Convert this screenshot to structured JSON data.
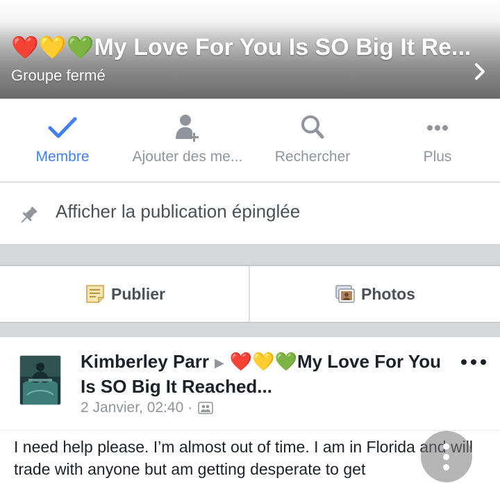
{
  "header": {
    "emojis": "❤️💛💚",
    "title": "My Love For You Is SO Big It Re...",
    "subtitle": "Groupe fermé",
    "chevron_icon": "chevron-right-icon"
  },
  "actions": [
    {
      "label": "Membre",
      "icon": "check-icon",
      "active": true
    },
    {
      "label": "Ajouter des me...",
      "icon": "add-person-icon",
      "active": false
    },
    {
      "label": "Rechercher",
      "icon": "search-icon",
      "active": false
    },
    {
      "label": "Plus",
      "icon": "more-dots-icon",
      "active": false
    }
  ],
  "pinned": {
    "label": "Afficher la publication épinglée",
    "icon": "pin-icon"
  },
  "compose": {
    "publish_label": "Publier",
    "photos_label": "Photos"
  },
  "post": {
    "author": "Kimberley Parr",
    "group_emojis": "❤️💛💚",
    "group_name": "My Love For You Is SO Big It Reached...",
    "time": "2 Janvier, 02:40 ·",
    "body": "I need help please. I’m almost out of time. I am in Florida and will trade with anyone but am getting desperate to get"
  },
  "colors": {
    "accent": "#4080ff",
    "muted": "#90949c",
    "separator": "#d5d7da"
  }
}
